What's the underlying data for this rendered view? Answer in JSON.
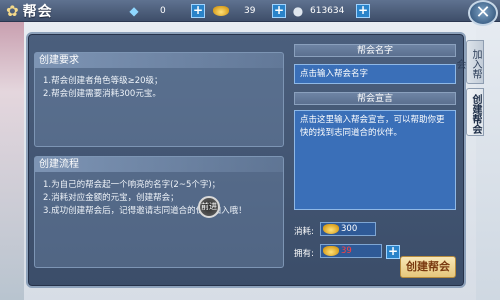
{
  "header": {
    "title": "帮会",
    "resources": [
      {
        "icon": "diamond-icon",
        "value": "0"
      },
      {
        "icon": "gold-ingot-icon",
        "value": "39"
      },
      {
        "icon": "silver-coin-icon",
        "value": "613634"
      }
    ]
  },
  "requirements": {
    "title": "创建要求",
    "lines": [
      "1.帮会创建者角色等级≥20级；",
      "2.帮会创建需要消耗300元宝。"
    ]
  },
  "process": {
    "title": "创建流程",
    "lines": [
      "1.为自己的帮会起一个响亮的名字(2~5个字)；",
      "2.消耗对应金额的元宝，创建帮会；",
      "3.成功创建帮会后，记得邀请志同道合的伙伴加入哦！"
    ]
  },
  "guild_name": {
    "heading": "帮会名字",
    "placeholder": "点击输入帮会名字"
  },
  "guild_declaration": {
    "heading": "帮会宣言",
    "placeholder": "点击这里输入帮会宣言，可以帮助你更快的找到志同道合的伙伴。"
  },
  "cost": {
    "label": "消耗:",
    "value": "300"
  },
  "owned": {
    "label": "拥有:",
    "value": "39",
    "value_color": "#ff4040"
  },
  "create_button": "创建帮会",
  "tabs": [
    {
      "label": "加入帮会",
      "active": false
    },
    {
      "label": "创建帮会",
      "active": true
    }
  ],
  "cursor_label": "前进"
}
